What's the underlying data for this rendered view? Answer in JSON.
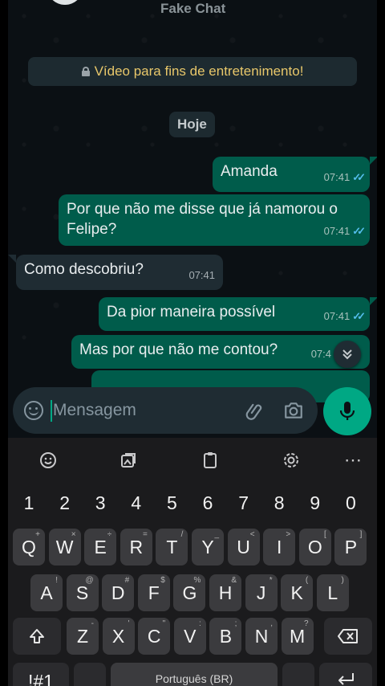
{
  "header": {
    "title": "Fake Chat"
  },
  "notice": {
    "text": "Vídeo para fins de entretenimento!"
  },
  "date_chip": "Hoje",
  "messages": [
    {
      "dir": "out",
      "text": "Amanda",
      "time": "07:41",
      "read": true
    },
    {
      "dir": "out",
      "text": "Por que não me disse que já namorou o Felipe?",
      "time": "07:41",
      "read": true
    },
    {
      "dir": "in",
      "text": "Como descobriu?",
      "time": "07:41"
    },
    {
      "dir": "out",
      "text": "Da pior maneira possível",
      "time": "07:41",
      "read": true
    },
    {
      "dir": "out",
      "text": "Mas por que não me contou?",
      "time": "07:4",
      "read": false
    }
  ],
  "composer": {
    "placeholder": "Mensagem"
  },
  "icons": {
    "emoji": "emoji-icon",
    "attach": "paperclip-icon",
    "camera": "camera-icon",
    "mic": "mic-icon",
    "scroll": "chevrons-down-icon"
  },
  "keyboard": {
    "toolbar": [
      "emoji-icon",
      "sticker-icon",
      "clipboard-icon",
      "gear-icon",
      "more-icon"
    ],
    "more": "⋯",
    "numbers": [
      "1",
      "2",
      "3",
      "4",
      "5",
      "6",
      "7",
      "8",
      "9",
      "0"
    ],
    "row1": [
      {
        "k": "Q",
        "s": "+"
      },
      {
        "k": "W",
        "s": "×"
      },
      {
        "k": "E",
        "s": "÷"
      },
      {
        "k": "R",
        "s": "="
      },
      {
        "k": "T",
        "s": "/"
      },
      {
        "k": "Y",
        "s": "_"
      },
      {
        "k": "U",
        "s": "<"
      },
      {
        "k": "I",
        "s": ">"
      },
      {
        "k": "O",
        "s": "["
      },
      {
        "k": "P",
        "s": "]"
      }
    ],
    "row2": [
      {
        "k": "A",
        "s": "!"
      },
      {
        "k": "S",
        "s": "@"
      },
      {
        "k": "D",
        "s": "#"
      },
      {
        "k": "F",
        "s": "$"
      },
      {
        "k": "G",
        "s": "%"
      },
      {
        "k": "H",
        "s": "&"
      },
      {
        "k": "J",
        "s": "*"
      },
      {
        "k": "K",
        "s": "("
      },
      {
        "k": "L",
        "s": ")"
      }
    ],
    "row3": [
      {
        "k": "Z",
        "s": "-"
      },
      {
        "k": "X",
        "s": "'"
      },
      {
        "k": "C",
        "s": "\""
      },
      {
        "k": "V",
        "s": ":"
      },
      {
        "k": "B",
        "s": ";"
      },
      {
        "k": "N",
        "s": ","
      },
      {
        "k": "M",
        "s": "?"
      }
    ],
    "symbols_label": "!#1",
    "space_label": "Português (BR)"
  },
  "colors": {
    "accent": "#00a884",
    "outgoing": "#005c4b",
    "incoming": "#1f2c33",
    "read_ticks": "#53bdeb",
    "notice": "#e8c76a"
  }
}
